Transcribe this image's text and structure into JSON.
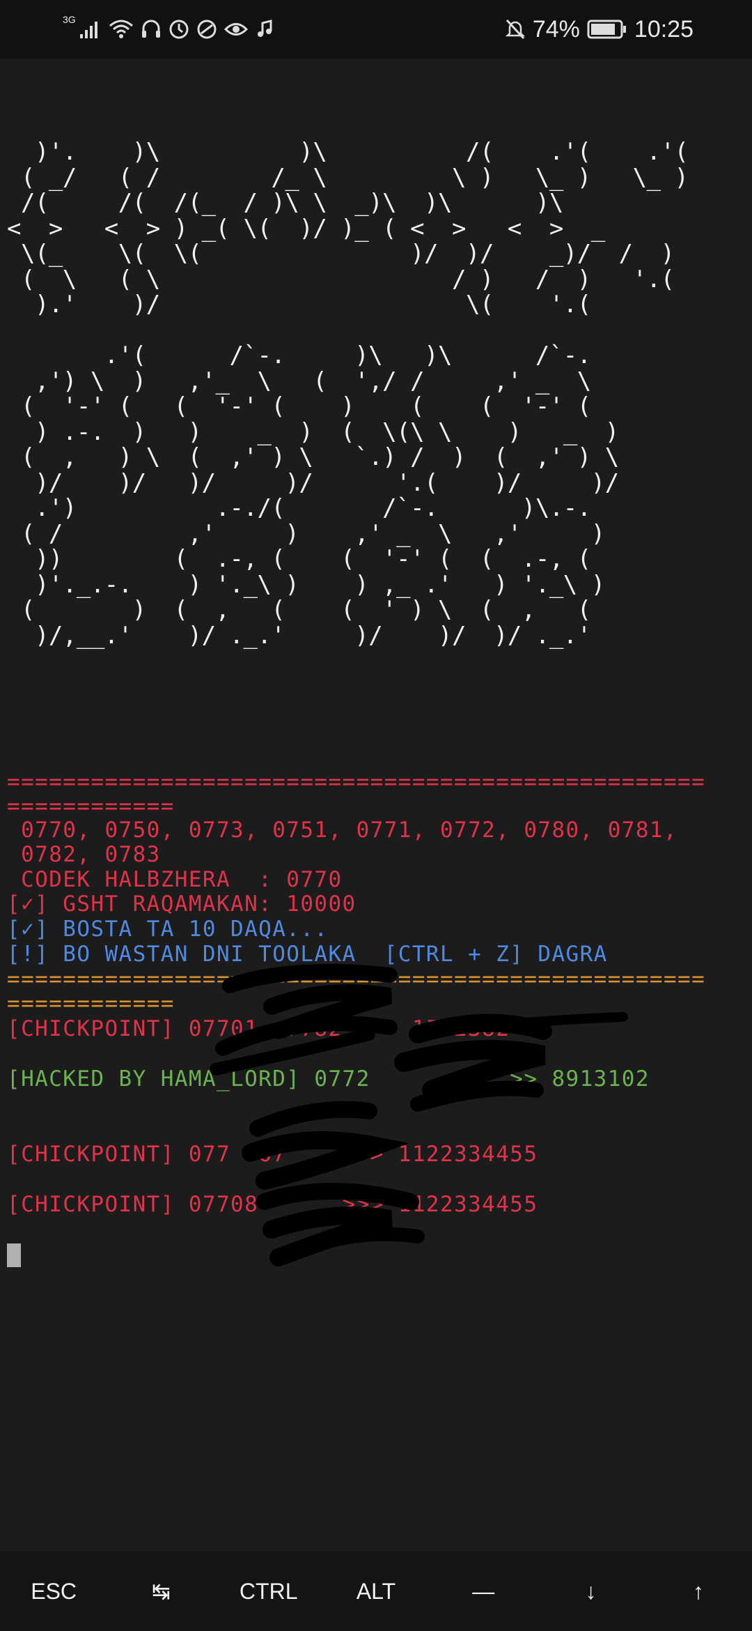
{
  "status_bar": {
    "network": "3G",
    "battery": "74%",
    "time": "10:25"
  },
  "banner_lines": [
    "  )'.    )\\          )\\          /(    .'(    .'(",
    " ( _/   ( /        /_ \\         \\ )   \\_ )   \\_ )",
    " /(     /(  /(_  / )\\ \\  _)\\  )\\      )\\",
    "<  >   <  > ) _( \\(  )/ )_ ( <  >   <  >  _",
    " \\(_    \\(  \\(               )/  )/    _)/  /  )",
    " (  \\   ( \\                     / )   /  )   '.(",
    "  ).'    )/                      \\(    '.(",
    "",
    "       .'(      /`-.     )\\   )\\      /`-.",
    "  ,') \\  )   ,'_  \\   (  ',/ /     ,' _  \\",
    " (  '-' (   (  '-' (    )    (    (  '-' (",
    "  ) .-.  )   )    _  )  (  \\(\\ \\    )   _  )",
    " (  ,   ) \\  (  ,' ) \\   `.) /  )  (  ,' ) \\",
    "  )/    )/   )/     )/      '.(    )/     )/",
    "  .')          .-./(       /`-.      )\\.-.",
    " ( /         ,'     )    ,' _  \\   ,'     )",
    "  ))        (  .-, (    (  '-' (  (  .-, (",
    "  )'._.-.    ) '._\\ )    ) ,_ .'   ) '._\\ )",
    " (       )  (  ,   (    (  ' ) \\  (  ,   (",
    "  )/,__.'    )/ ._.'     )/    )/  )/ ._.'"
  ],
  "terminal": {
    "sep_red_1": "==================================================",
    "sep_red_2": "============",
    "codes_1": " 0770, 0750, 0773, 0751, 0771, 0772, 0780, 0781,",
    "codes_2": " 0782, 0783",
    "codek": " CODEK HALBZHERA  : 0770",
    "gsht": "[✓] GSHT RAQAMAKAN: 10000",
    "bosta": "[✓] BOSTA TA 10 DAQA...",
    "bo_wastan": "[!] BO WASTAN DNI TOOLAKA  [CTRL + Z] DAGRA",
    "sep_orange_1": "==================================================",
    "sep_orange_2": "============",
    "result_1": "[CHICKPOINT] 07701  7782 >>> 1552382",
    "result_2": "[HACKED BY HAMA_LORD] 0772          >> 8913102",
    "result_3": "[CHICKPOINT] 077  67    >>> 1122334455",
    "result_4": "[CHICKPOINT] 07708      >>> 1122334455"
  },
  "extra_keys": [
    "ESC",
    "↹",
    "CTRL",
    "ALT",
    "—",
    "↓",
    "↑"
  ],
  "colors": {
    "red": "#e0334a",
    "orange": "#d9902e",
    "blue": "#4f8ae0",
    "green": "#6bb34f",
    "background": "#1c1c1c"
  }
}
